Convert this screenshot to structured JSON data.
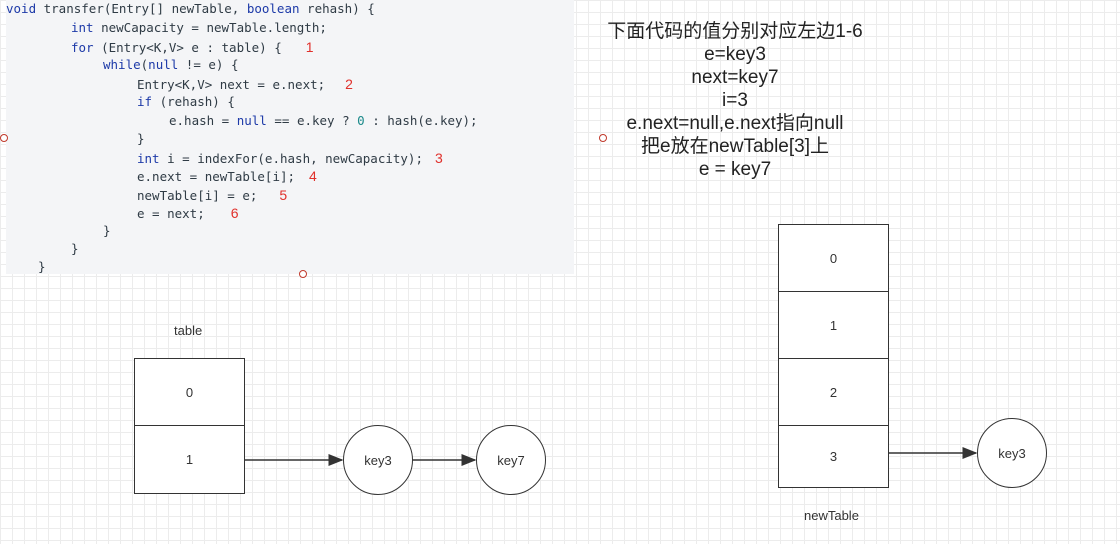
{
  "code": {
    "l1a": "void",
    "l1b": " transfer(Entry[] newTable, ",
    "l1c": "boolean",
    "l1d": " rehash) {",
    "l2a": "int",
    "l2b": " newCapacity = newTable.length;",
    "l3a": "for",
    "l3b": " (Entry<K,V> e : table) {",
    "l3m": "1",
    "l4a": "while",
    "l4b": "(",
    "l4c": "null",
    "l4d": " != e) {",
    "l5a": "Entry<K,V> next = e.next;",
    "l5m": "2",
    "l6a": "if",
    "l6b": " (rehash) {",
    "l7a": "e.hash = ",
    "l7b": "null",
    "l7c": " == e.key ? ",
    "l7d": "0",
    "l7e": " : hash(e.key);",
    "l8a": "}",
    "l9a": "int",
    "l9b": " i = indexFor(e.hash, newCapacity);",
    "l9m": "3",
    "l10a": "e.next = newTable[i];",
    "l10m": "4",
    "l11a": "newTable[i] = e;",
    "l11m": "5",
    "l12a": "e = next;",
    "l12m": "6",
    "l13a": "}",
    "l14a": "}",
    "l15a": "}"
  },
  "notes": [
    "下面代码的值分别对应左边1-6",
    "e=key3",
    "next=key7",
    "i=3",
    "e.next=null,e.next指向null",
    "把e放在newTable[3]上",
    "e = key7"
  ],
  "table": {
    "label": "table",
    "cells": [
      "0",
      "1"
    ],
    "chain": [
      "key3",
      "key7"
    ]
  },
  "newTable": {
    "label": "newTable",
    "cells": [
      "0",
      "1",
      "2",
      "3"
    ],
    "chain": [
      "key3"
    ]
  }
}
